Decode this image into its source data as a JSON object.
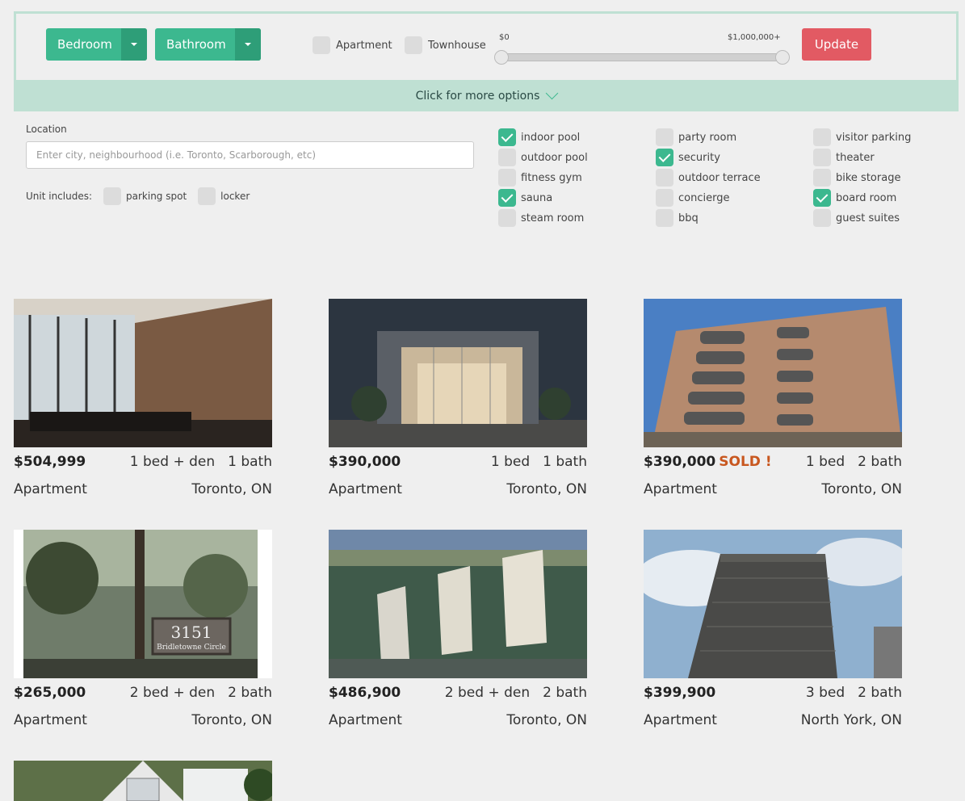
{
  "filters": {
    "bedroom_label": "Bedroom",
    "bathroom_label": "Bathroom",
    "type_apartment": "Apartment",
    "type_townhouse": "Townhouse",
    "price_min": "$0",
    "price_max": "$1,000,000+",
    "update_label": "Update",
    "more_options": "Click for more options"
  },
  "options": {
    "location_label": "Location",
    "location_placeholder": "Enter city, neighbourhood (i.e. Toronto, Scarborough, etc)",
    "unit_includes": "Unit includes:",
    "parking_spot": "parking spot",
    "locker": "locker",
    "amenities": [
      {
        "label": "indoor pool",
        "checked": true
      },
      {
        "label": "outdoor pool",
        "checked": false
      },
      {
        "label": "fitness gym",
        "checked": false
      },
      {
        "label": "sauna",
        "checked": true
      },
      {
        "label": "steam room",
        "checked": false
      },
      {
        "label": "party room",
        "checked": false
      },
      {
        "label": "security",
        "checked": true
      },
      {
        "label": "outdoor terrace",
        "checked": false
      },
      {
        "label": "concierge",
        "checked": false
      },
      {
        "label": "bbq",
        "checked": false
      },
      {
        "label": "visitor parking",
        "checked": false
      },
      {
        "label": "theater",
        "checked": false
      },
      {
        "label": "bike storage",
        "checked": false
      },
      {
        "label": "board room",
        "checked": true
      },
      {
        "label": "guest suites",
        "checked": false
      }
    ]
  },
  "listings": [
    {
      "price": "$504,999",
      "sold": "",
      "beds": "1 bed + den",
      "baths": "1 bath",
      "type": "Apartment",
      "city": "Toronto, ON"
    },
    {
      "price": "$390,000",
      "sold": "",
      "beds": "1 bed",
      "baths": "1 bath",
      "type": "Apartment",
      "city": "Toronto, ON"
    },
    {
      "price": "$390,000",
      "sold": "SOLD !",
      "beds": "1 bed",
      "baths": "2 bath",
      "type": "Apartment",
      "city": "Toronto, ON"
    },
    {
      "price": "$265,000",
      "sold": "",
      "beds": "2 bed + den",
      "baths": "2 bath",
      "type": "Apartment",
      "city": "Toronto, ON",
      "sign": "3151",
      "sign_sub": "Bridletowne Circle"
    },
    {
      "price": "$486,900",
      "sold": "",
      "beds": "2 bed + den",
      "baths": "2 bath",
      "type": "Apartment",
      "city": "Toronto, ON"
    },
    {
      "price": "$399,900",
      "sold": "",
      "beds": "3 bed",
      "baths": "2 bath",
      "type": "Apartment",
      "city": "North York, ON"
    }
  ],
  "colors": {
    "accent": "#3cb88f",
    "update": "#e25a63",
    "sold": "#c8571f",
    "band": "#bfe0d3"
  }
}
